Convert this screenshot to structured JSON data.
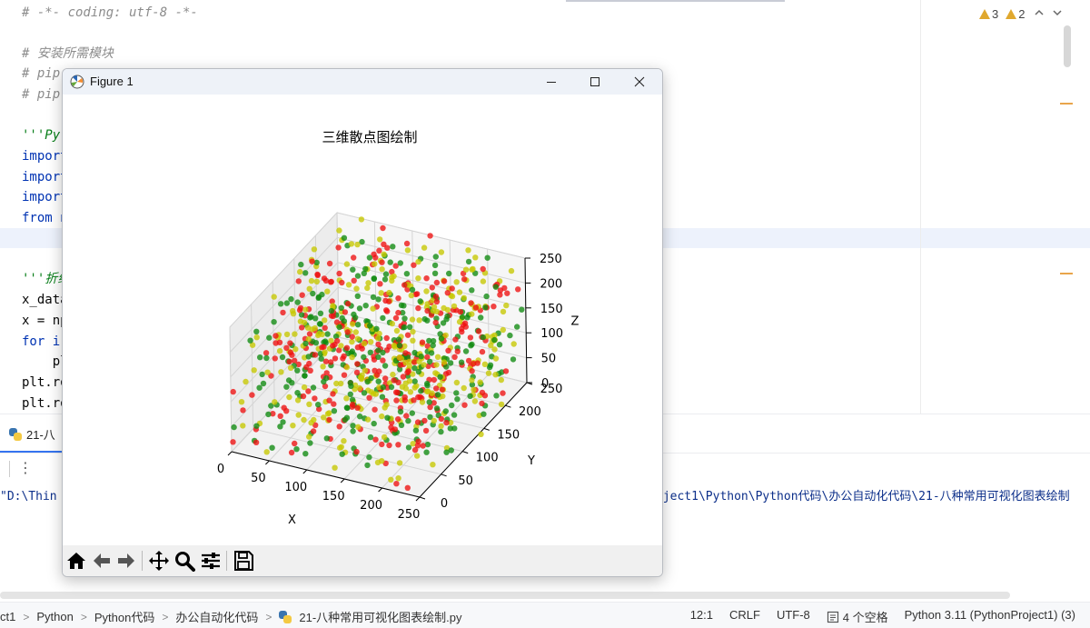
{
  "editor": {
    "lines": [
      {
        "text": "# -*- coding: utf-8 -*-",
        "kind": "comment"
      },
      {
        "text": "# 安装所需模块",
        "kind": "comment"
      },
      {
        "text": "# pip",
        "kind": "comment"
      },
      {
        "text": "# pip",
        "kind": "comment"
      },
      {
        "text": "'''Py",
        "kind": "docstr"
      },
      {
        "text": "import",
        "kind": "kw"
      },
      {
        "text": "import",
        "kind": "kw"
      },
      {
        "text": "import",
        "kind": "kw"
      },
      {
        "text": "from n",
        "kind": "kw"
      },
      {
        "text": "'''折线",
        "kind": "docstr"
      },
      {
        "text": "x_data",
        "kind": "plain"
      },
      {
        "text": "x = np",
        "kind": "plain"
      },
      {
        "text": "for i",
        "kind": "kw"
      },
      {
        "text": "    pl",
        "kind": "plain"
      },
      {
        "text": "plt.ro",
        "kind": "plain"
      },
      {
        "text": "plt.ro",
        "kind": "plain"
      }
    ],
    "warnings_count": "3",
    "weak_warnings_count": "2",
    "nav_up": "^",
    "nav_down": "v"
  },
  "run_panel": {
    "tab_label": "21-八",
    "more_icon": "⋮",
    "console_left": "\"D:\\Thin",
    "console_right": "oject1\\Python\\Python代码\\办公自动化代码\\21-八种常用可视化图表绘制"
  },
  "statusbar": {
    "breadcrumbs": [
      "ct1",
      "Python",
      "Python代码",
      "办公自动化代码",
      "21-八种常用可视化图表绘制.py"
    ],
    "position": "12:1",
    "line_sep": "CRLF",
    "encoding": "UTF-8",
    "indent": "4 个空格",
    "interpreter": "Python 3.11 (PythonProject1) (3)"
  },
  "figure_window": {
    "title": "Figure 1",
    "toolbar_icons": [
      "home-icon",
      "back-icon",
      "forward-icon",
      "pan-icon",
      "zoom-icon",
      "configure-icon",
      "save-icon"
    ],
    "colors": {
      "red": "#ee1111",
      "green": "#108a10",
      "yellow": "#c6c800"
    }
  },
  "chart_data": {
    "type": "scatter",
    "projection": "3d",
    "title": "三维散点图绘制",
    "xlabel": "X",
    "ylabel": "Y",
    "zlabel": "Z",
    "xlim": [
      0,
      250
    ],
    "ylim": [
      0,
      250
    ],
    "zlim": [
      0,
      250
    ],
    "xticks": [
      0,
      50,
      100,
      150,
      200,
      250
    ],
    "yticks": [
      0,
      50,
      100,
      150,
      200,
      250
    ],
    "zticks": [
      0,
      50,
      100,
      150,
      200,
      250
    ],
    "series_colors": [
      "red",
      "green",
      "yellow"
    ],
    "points_per_color": 300,
    "distribution": "uniform random integers 0-255 in x, y, z",
    "grid": true
  }
}
